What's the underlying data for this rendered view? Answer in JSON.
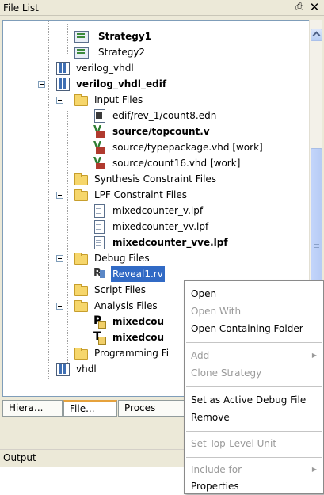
{
  "panel": {
    "title": "File List",
    "pin_icon": "pin-icon",
    "close_icon": "close-icon"
  },
  "tree": {
    "strategy1": "Strategy1",
    "strategy2": "Strategy2",
    "verilog_vhdl": "verilog_vhdl",
    "verilog_vhdl_edif": "verilog_vhdl_edif",
    "input_files": "Input Files",
    "count8_edn": "edif/rev_1/count8.edn",
    "topcount_v": "source/topcount.v",
    "typepackage": "source/typepackage.vhd [work]",
    "count16": "source/count16.vhd [work]",
    "synthesis_constraint": "Synthesis Constraint Files",
    "lpf_constraint": "LPF Constraint Files",
    "lpf_v": "mixedcounter_v.lpf",
    "lpf_vv": "mixedcounter_vv.lpf",
    "lpf_vve": "mixedcounter_vve.lpf",
    "debug_files": "Debug Files",
    "reveal1": "Reveal1.rv",
    "script_files": "Script Files",
    "analysis_files": "Analysis Files",
    "analysis_item1": "mixedcou",
    "analysis_item2": "mixedcou",
    "programming_files": "Programming Fi",
    "vhdl": "vhdl"
  },
  "tabs": [
    "Hiera...",
    "File...",
    "Proces"
  ],
  "active_tab": 1,
  "output": {
    "title": "Output"
  },
  "context_menu": {
    "open": "Open",
    "open_with": "Open With",
    "open_containing_folder": "Open Containing Folder",
    "add": "Add",
    "clone_strategy": "Clone Strategy",
    "set_active_debug": "Set as Active Debug File",
    "remove": "Remove",
    "set_top_level": "Set Top-Level Unit",
    "include_for": "Include for",
    "properties": "Properties"
  },
  "colors": {
    "selection": "#316ac5",
    "panel_bg": "#ece9d8",
    "tab_accent": "#e6a23c"
  }
}
